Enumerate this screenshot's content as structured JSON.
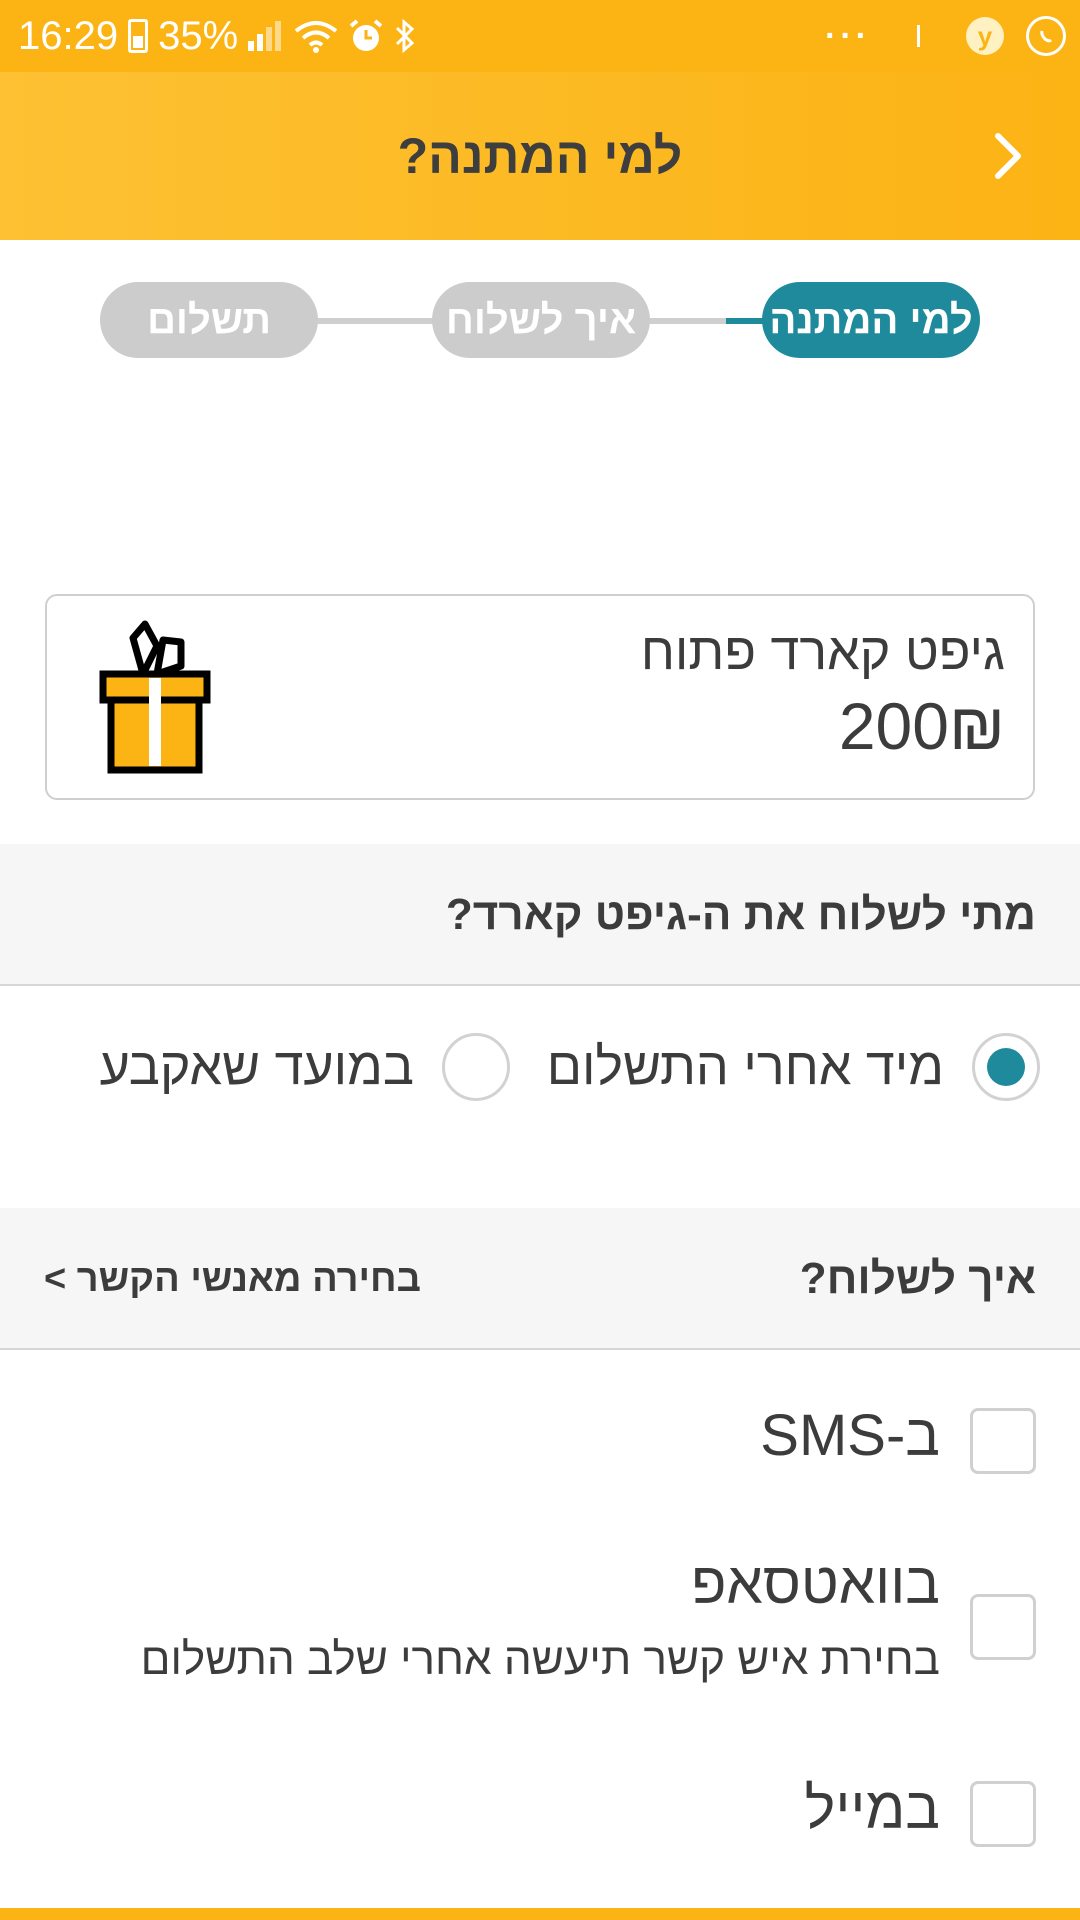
{
  "status_bar": {
    "time": "16:29",
    "battery": "35%",
    "dots": "···",
    "yes_badge": "y"
  },
  "header": {
    "title": "למי המתנה?"
  },
  "stepper": {
    "steps": [
      {
        "label": "למי המתנה",
        "active": true
      },
      {
        "label": "איך לשלוח",
        "active": false
      },
      {
        "label": "תשלום",
        "active": false
      }
    ]
  },
  "gift_card": {
    "name": "גיפט קארד פתוח",
    "amount": "200₪"
  },
  "when_section": {
    "title": "מתי לשלוח את ה-גיפט קארד?",
    "options": [
      {
        "label": "מיד אחרי התשלום",
        "checked": true
      },
      {
        "label": "במועד שאקבע",
        "checked": false
      }
    ]
  },
  "how_section": {
    "title": "איך לשלוח?",
    "contacts_link": "בחירה מאנשי הקשר >",
    "options": [
      {
        "label": "ב-SMS",
        "sub": ""
      },
      {
        "label": "בוואטסאפ",
        "sub": "בחירת איש קשר תיעשה אחרי שלב התשלום"
      },
      {
        "label": "במייל",
        "sub": ""
      }
    ]
  },
  "colors": {
    "brand_yellow": "#fcb314",
    "accent_teal": "#1e8a9c",
    "inactive_gray": "#cccccc"
  }
}
